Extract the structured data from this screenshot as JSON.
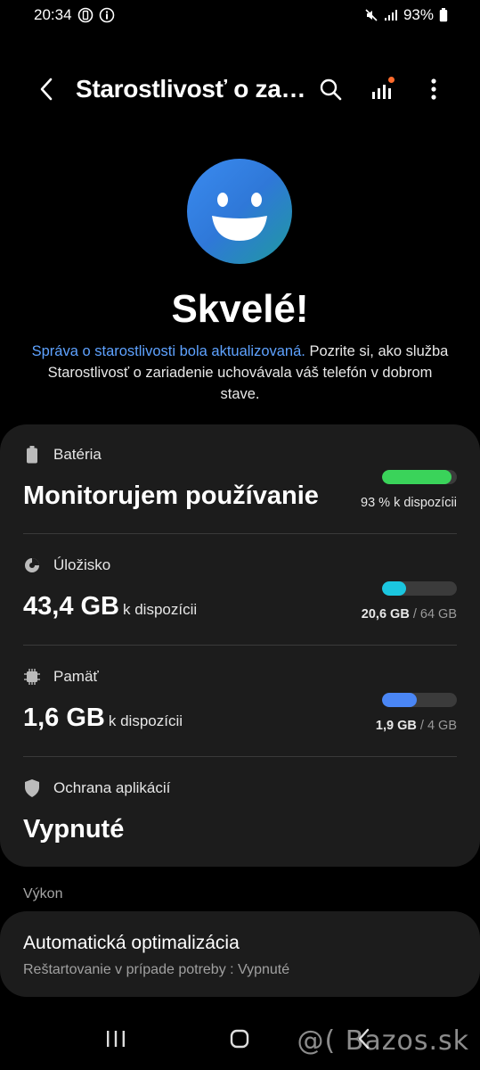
{
  "status_bar": {
    "time": "20:34",
    "battery_percent": "93%",
    "icons": [
      "data-saver-icon",
      "info-icon",
      "mute-icon",
      "signal-icon",
      "battery-icon"
    ]
  },
  "app_bar": {
    "title": "Starostlivosť o zariadenie",
    "icons": [
      "back-icon",
      "search-icon",
      "diagnostics-icon",
      "more-icon"
    ]
  },
  "hero": {
    "title": "Skvelé!",
    "link_text": "Správa o starostlivosti bola aktualizovaná.",
    "description": " Pozrite si, ako služba Starostlivosť o zariadenie uchovávala váš telefón v dobrom stave."
  },
  "battery": {
    "label": "Batéria",
    "value": "Monitorujem používanie",
    "caption": "93 % k dispozícii",
    "fill": 0.93,
    "color": "#3ad35a"
  },
  "storage": {
    "label": "Úložisko",
    "value": "43,4 GB",
    "unit": "k dispozícii",
    "used": "20,6 GB",
    "total": "64 GB",
    "fill": 0.32,
    "color": "#1bc6df"
  },
  "memory": {
    "label": "Pamäť",
    "value": "1,6 GB",
    "unit": "k dispozícii",
    "used": "1,9 GB",
    "total": "4 GB",
    "fill": 0.47,
    "color": "#4a86f5"
  },
  "app_protection": {
    "label": "Ochrana aplikácií",
    "value": "Vypnuté"
  },
  "performance": {
    "header": "Výkon",
    "title": "Automatická optimalizácia",
    "subtitle": "Reštartovanie v prípade potreby : Vypnuté"
  },
  "nav": {
    "icons": [
      "recents-icon",
      "home-icon",
      "back-nav-icon"
    ]
  },
  "watermark": "@( Bazos.sk"
}
